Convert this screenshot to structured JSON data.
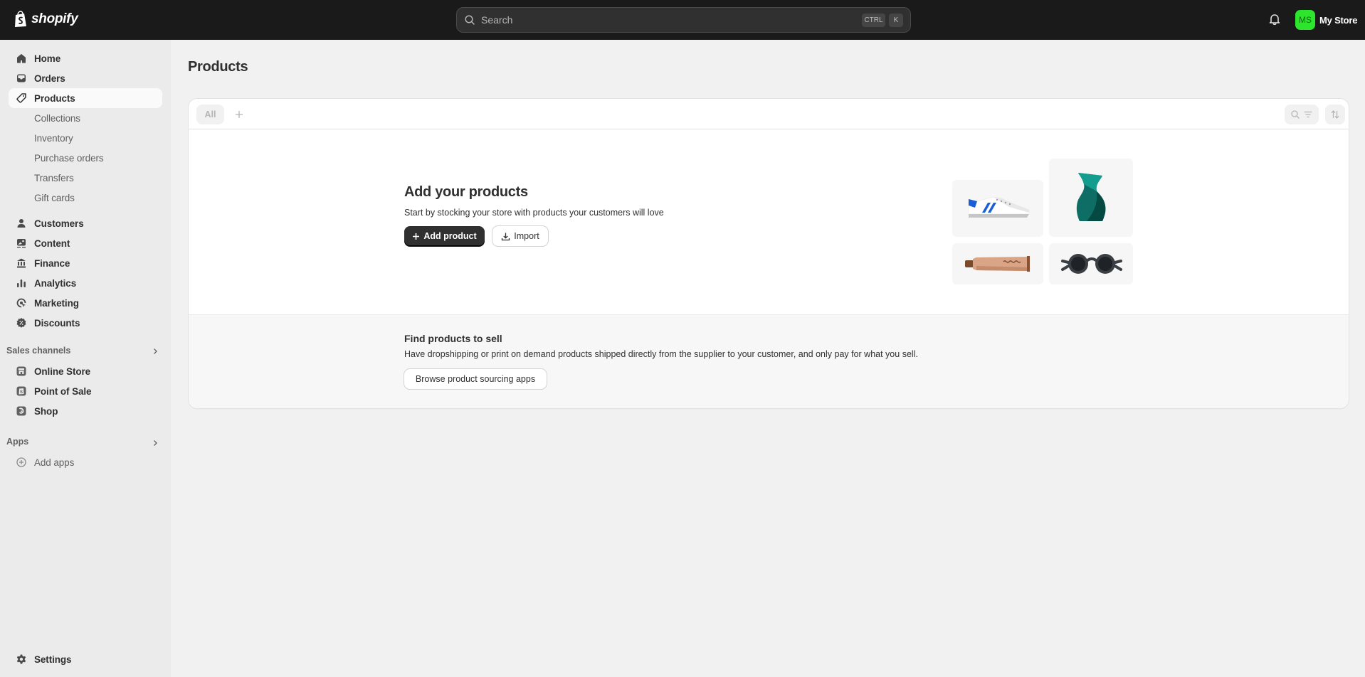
{
  "topbar": {
    "logo_text": "shopify",
    "search_placeholder": "Search",
    "shortcut_keys": [
      "CTRL",
      "K"
    ],
    "store": {
      "initials": "MS",
      "name": "My Store",
      "avatar_color": "#2ee52e"
    }
  },
  "sidebar": {
    "main_items": [
      {
        "label": "Home",
        "icon": "home-icon"
      },
      {
        "label": "Orders",
        "icon": "inbox-icon"
      },
      {
        "label": "Products",
        "icon": "tag-icon",
        "active": true
      }
    ],
    "product_sub_items": [
      {
        "label": "Collections"
      },
      {
        "label": "Inventory"
      },
      {
        "label": "Purchase orders"
      },
      {
        "label": "Transfers"
      },
      {
        "label": "Gift cards"
      }
    ],
    "more_items": [
      {
        "label": "Customers",
        "icon": "person-icon"
      },
      {
        "label": "Content",
        "icon": "image-icon"
      },
      {
        "label": "Finance",
        "icon": "bank-icon"
      },
      {
        "label": "Analytics",
        "icon": "bar-chart-icon"
      },
      {
        "label": "Marketing",
        "icon": "target-icon"
      },
      {
        "label": "Discounts",
        "icon": "discount-icon"
      }
    ],
    "sales_channels": {
      "heading": "Sales channels",
      "items": [
        {
          "label": "Online Store",
          "icon": "storefront-icon"
        },
        {
          "label": "Point of Sale",
          "icon": "pos-icon"
        },
        {
          "label": "Shop",
          "icon": "shop-icon"
        }
      ]
    },
    "apps": {
      "heading": "Apps",
      "items": [
        {
          "label": "Add apps",
          "icon": "plus-circle-icon"
        }
      ]
    },
    "settings_label": "Settings"
  },
  "main": {
    "page_title": "Products",
    "tabs": [
      {
        "label": "All",
        "selected": true
      }
    ],
    "empty_state": {
      "title": "Add your products",
      "subtitle": "Start by stocking your store with products your customers will love",
      "primary_button": "Add product",
      "secondary_button": "Import",
      "illustrations": [
        "sneaker",
        "vase",
        "tube",
        "sunglasses"
      ]
    },
    "sourcing": {
      "title": "Find products to sell",
      "description": "Have dropshipping or print on demand products shipped directly from the supplier to your customer, and only pay for what you sell.",
      "button": "Browse product sourcing apps"
    }
  }
}
